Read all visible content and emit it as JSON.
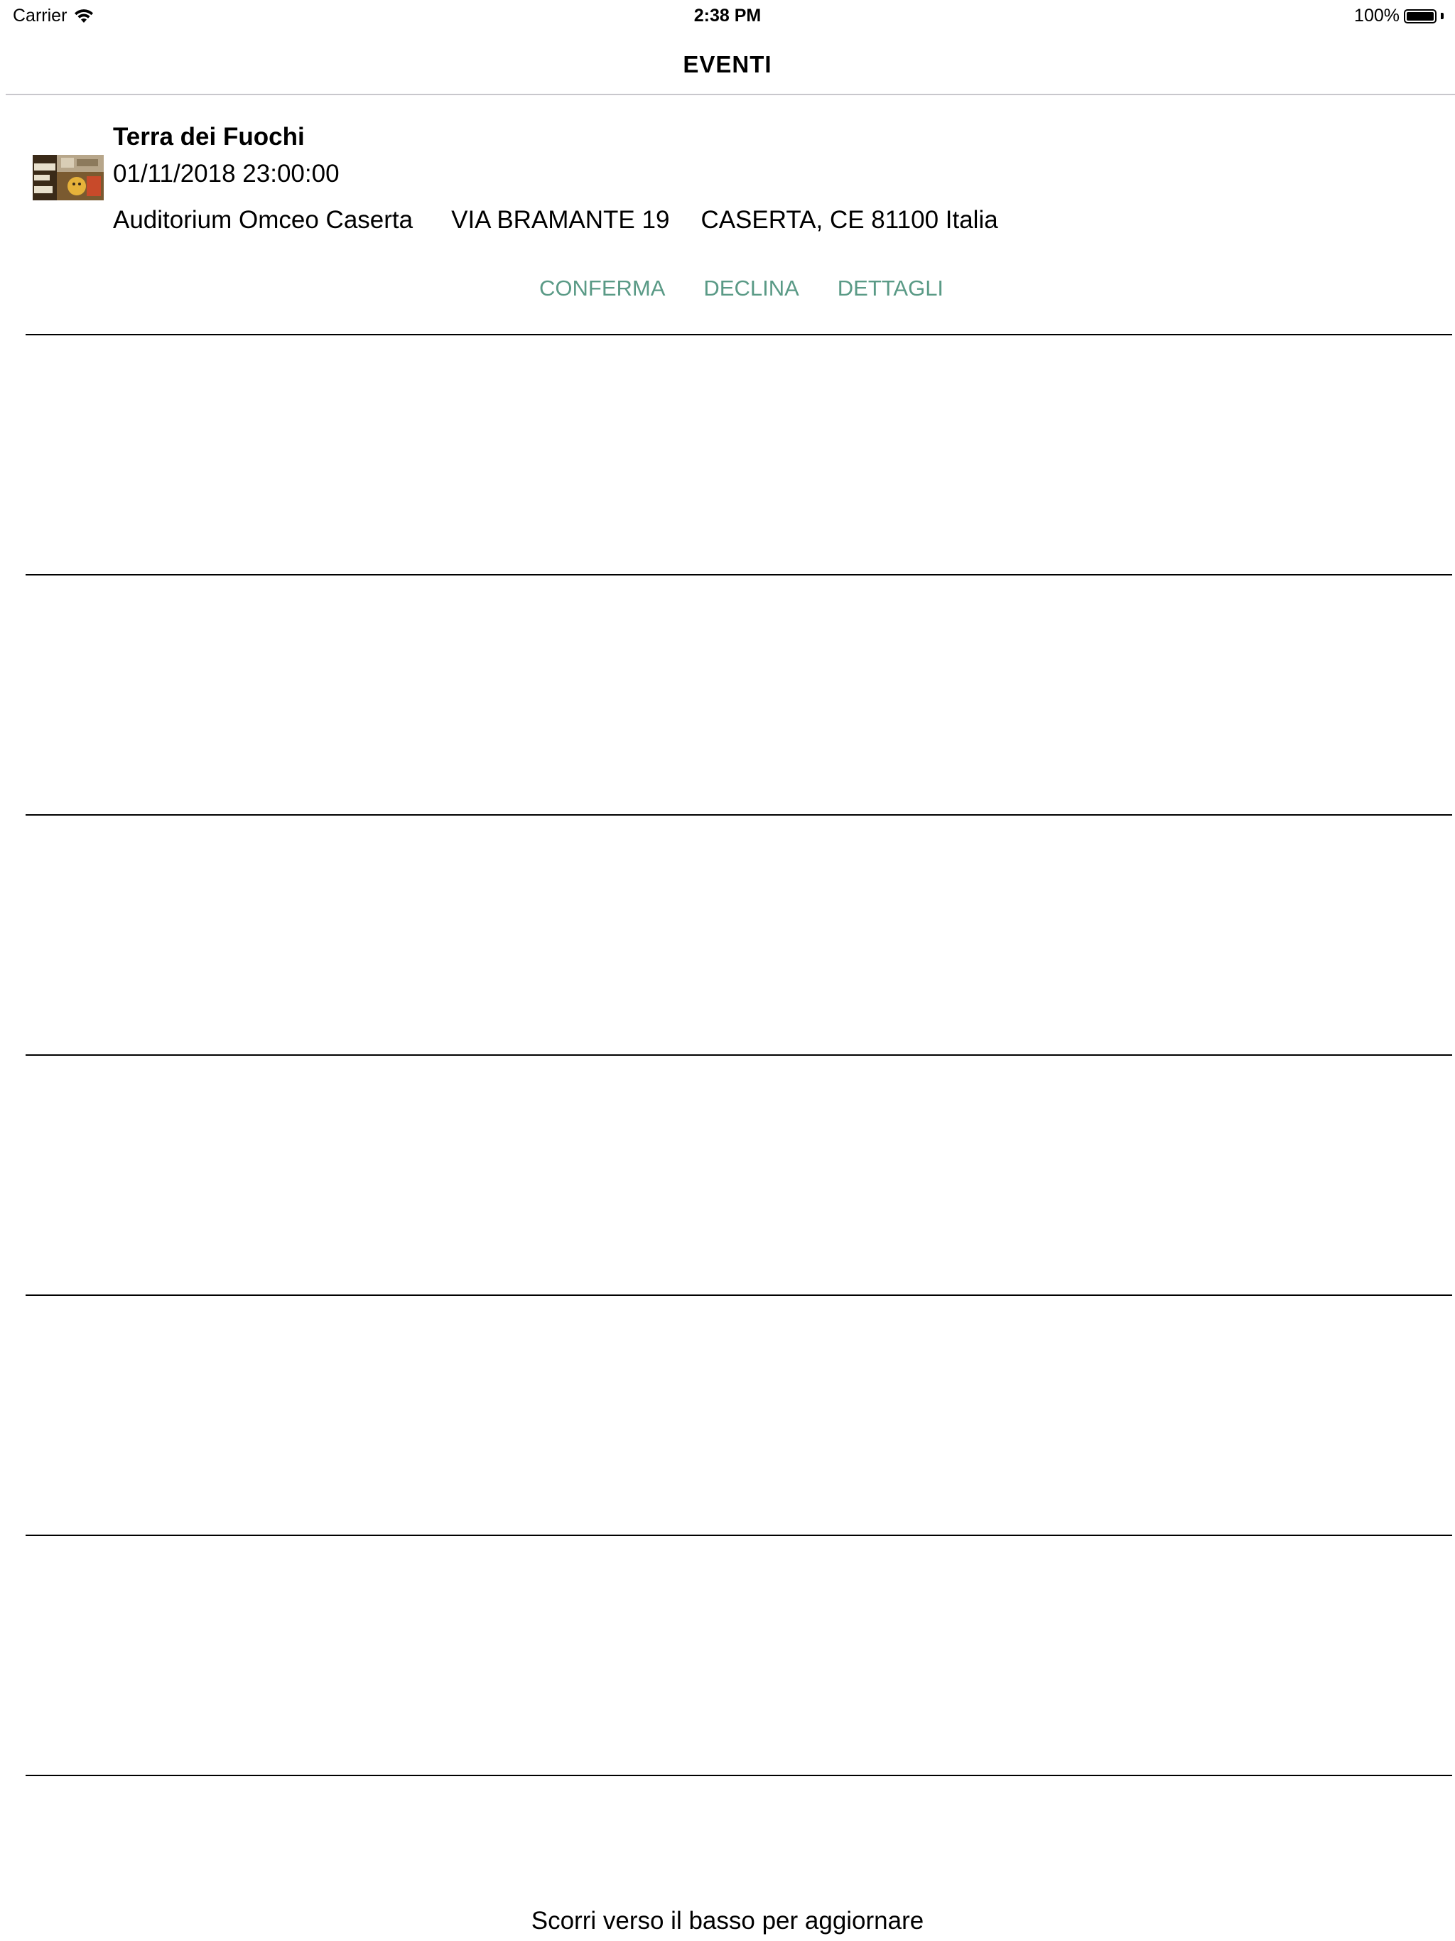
{
  "status_bar": {
    "carrier": "Carrier",
    "time": "2:38 PM",
    "battery": "100%",
    "icons": [
      "wifi-icon",
      "battery-icon"
    ]
  },
  "nav": {
    "title": "EVENTI"
  },
  "event": {
    "thumbnail_icon": "event-thumbnail",
    "title": "Terra dei Fuochi",
    "datetime": "01/11/2018 23:00:00",
    "venue": "Auditorium Omceo Caserta",
    "street": "VIA BRAMANTE 19",
    "city": "CASERTA, CE 81100 Italia",
    "actions": {
      "confirm": "CONFERMA",
      "decline": "DECLINA",
      "details": "DETTAGLI"
    },
    "accent_color": "#5a9a86"
  },
  "footer": {
    "hint": "Scorri verso il basso per aggiornare"
  }
}
